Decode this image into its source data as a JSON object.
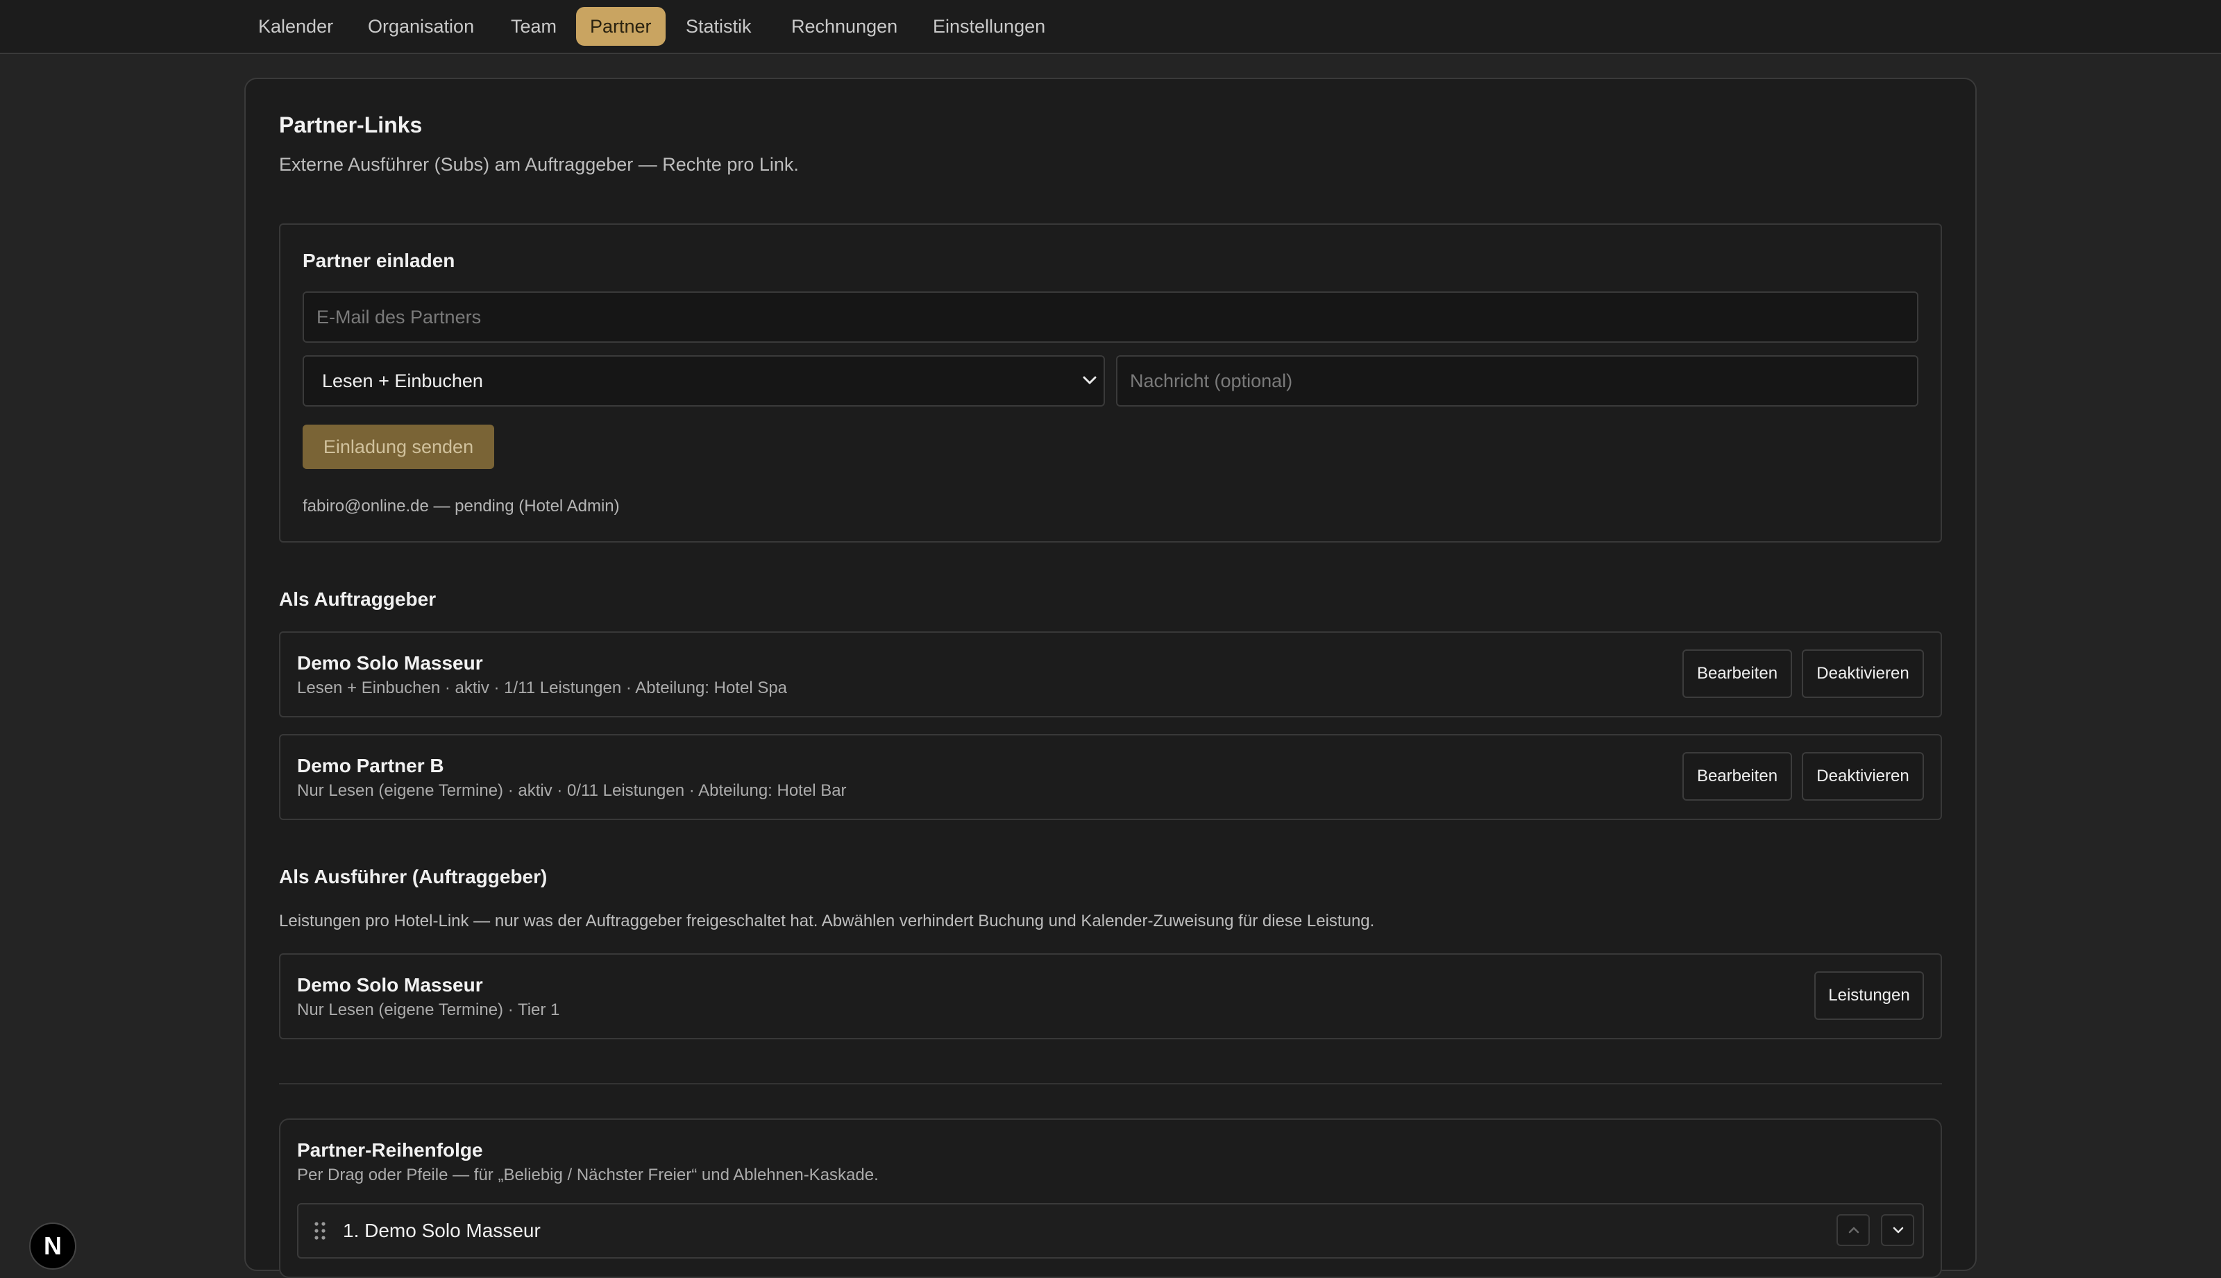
{
  "nav": {
    "tabs": [
      {
        "label": "Kalender"
      },
      {
        "label": "Organisation"
      },
      {
        "label": "Team"
      },
      {
        "label": "Partner",
        "active": true
      },
      {
        "label": "Statistik"
      },
      {
        "label": "Rechnungen"
      },
      {
        "label": "Einstellungen"
      }
    ]
  },
  "page": {
    "title": "Partner-Links",
    "subtitle": "Externe Ausführer (Subs) am Auftraggeber — Rechte pro Link."
  },
  "invite": {
    "title": "Partner einladen",
    "email_placeholder": "E-Mail des Partners",
    "email_value": "",
    "role_selected": "Lesen + Einbuchen",
    "message_placeholder": "Nachricht (optional)",
    "message_value": "",
    "send_label": "Einladung senden",
    "pending": "fabiro@online.de — pending (Hotel Admin)"
  },
  "as_client": {
    "heading": "Als Auftraggeber",
    "items": [
      {
        "name": "Demo Solo Masseur",
        "details": "Lesen + Einbuchen · aktiv · 1/11 Leistungen · Abteilung: Hotel Spa",
        "edit_label": "Bearbeiten",
        "deactivate_label": "Deaktivieren"
      },
      {
        "name": "Demo Partner B",
        "details": "Nur Lesen (eigene Termine) · aktiv · 0/11 Leistungen · Abteilung: Hotel Bar",
        "edit_label": "Bearbeiten",
        "deactivate_label": "Deaktivieren"
      }
    ]
  },
  "as_executor": {
    "heading": "Als Ausführer (Auftraggeber)",
    "description": "Leistungen pro Hotel-Link — nur was der Auftraggeber freigeschaltet hat. Abwählen verhindert Buchung und Kalender-Zuweisung für diese Leistung.",
    "items": [
      {
        "name": "Demo Solo Masseur",
        "details": "Nur Lesen (eigene Termine) · Tier 1",
        "services_label": "Leistungen"
      }
    ]
  },
  "order": {
    "title": "Partner-Reihenfolge",
    "subtitle": "Per Drag oder Pfeile — für „Beliebig / Nächster Freier“ und Ablehnen-Kaskade.",
    "items": [
      {
        "label": "1. Demo Solo Masseur"
      }
    ]
  },
  "badge": {
    "letter": "N"
  },
  "colors": {
    "accent": "#c9a461",
    "accent_muted": "#7a6436",
    "background": "#242424",
    "card": "#1c1c1c",
    "border": "#3a3a3a"
  }
}
